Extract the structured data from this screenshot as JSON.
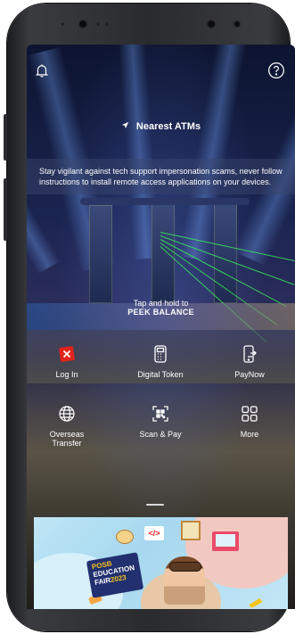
{
  "header": {
    "nearest_atms": "Nearest ATMs"
  },
  "notice": {
    "text": "Stay vigilant against tech support impersonation scams, never follow instructions to install remote access applications on your devices."
  },
  "peek": {
    "line1": "Tap and hold to",
    "line2": "PEEK BALANCE"
  },
  "actions": [
    {
      "label": "Log In",
      "icon": "login-icon"
    },
    {
      "label": "Digital Token",
      "icon": "digital-token-icon"
    },
    {
      "label": "PayNow",
      "icon": "paynow-icon"
    },
    {
      "label": "Overseas\nTransfer",
      "icon": "globe-icon"
    },
    {
      "label": "Scan & Pay",
      "icon": "qr-scan-icon"
    },
    {
      "label": "More",
      "icon": "grid-icon"
    }
  ],
  "banner": {
    "line1": "POSB",
    "line2": "EDUCATION",
    "line3": "FAIR",
    "year": "2023"
  },
  "colors": {
    "accent_red": "#e2231a",
    "laser_green": "#39ff5a",
    "banner_blue": "#a7d8ef",
    "fair_navy": "#22306f"
  }
}
